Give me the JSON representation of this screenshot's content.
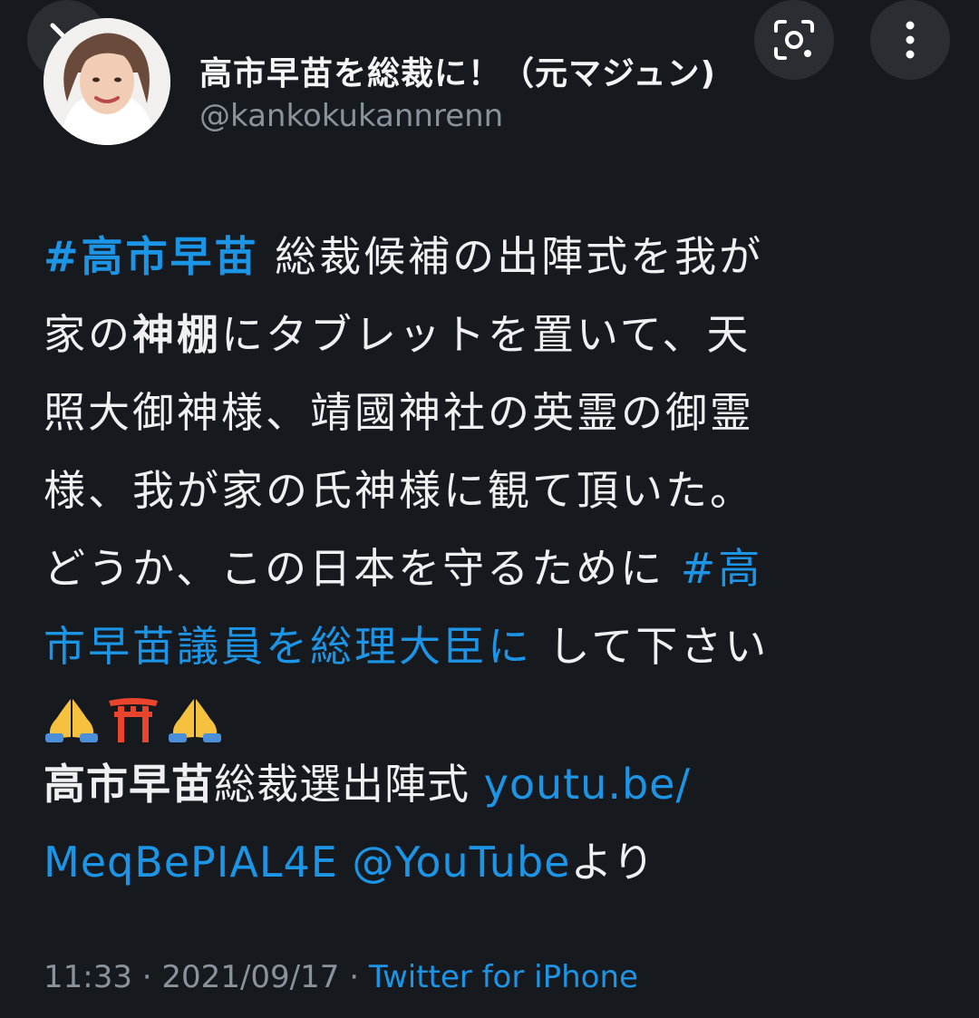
{
  "header": {
    "close_icon": "close-icon",
    "lens_icon": "lens-scan-icon",
    "more_icon": "more-vertical-icon",
    "display_name": "高市早苗を総裁に！（元マジュン)",
    "handle": "@kankokukannrenn"
  },
  "tweet": {
    "hashtag1": "#高市早苗",
    "line1_text": "総裁候補の出陣式を我が",
    "line2_a": "家の",
    "line2_bold": "神棚",
    "line2_b": "にタブレットを置いて、天",
    "line3": "照大御神様、靖國神社の英霊の御霊",
    "line4": "様、我が家の氏神様に観て頂いた。",
    "line5_text": "どうか、この日本を守るために",
    "line5_link": "#高",
    "line6_link": "市早苗議員を総理大臣に",
    "line6_text": "して下さい",
    "emoji": [
      "folded-hands-icon",
      "torii-gate-icon",
      "folded-hands-icon"
    ]
  },
  "source": {
    "title_bold": "高市早苗",
    "title_rest": "総裁選出陣式",
    "url_part1": "youtu.be/",
    "url_part2": "MeqBePIAL4E",
    "mention": "@YouTube",
    "suffix": "より"
  },
  "meta": {
    "time": "11:33",
    "sep1": "·",
    "date": "2021/09/17",
    "sep2": "·",
    "client": "Twitter for iPhone"
  },
  "colors": {
    "background": "#16191e",
    "link": "#1d95e6",
    "text": "#eef0f2",
    "muted": "#8a939c"
  }
}
